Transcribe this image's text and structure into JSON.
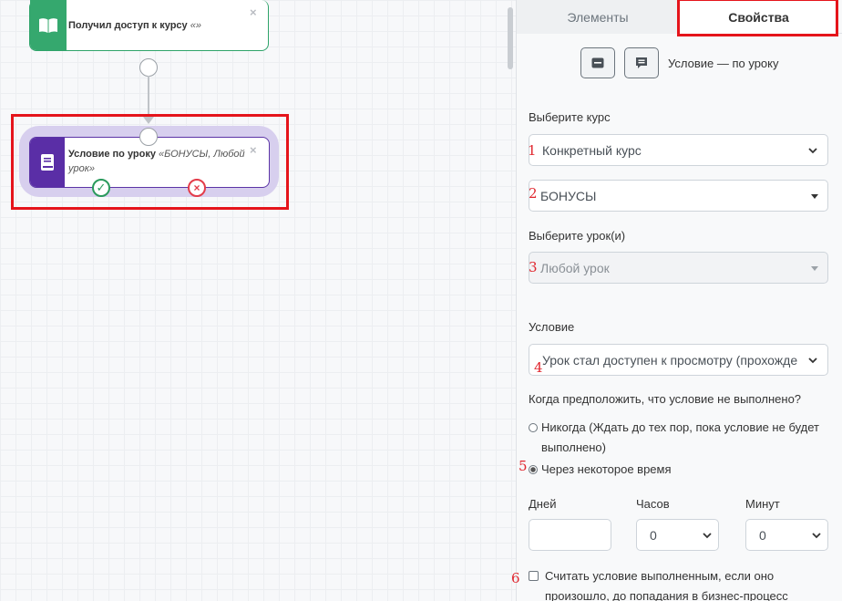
{
  "canvas": {
    "node1": {
      "title": "Получил доступ к курсу",
      "detail": "«»",
      "close": "×"
    },
    "node2": {
      "title": "Условие по уроку",
      "detail": "«БОНУСЫ, Любой урок»",
      "close": "×"
    },
    "ok_symbol": "✓",
    "fail_symbol": "×"
  },
  "colors": {
    "highlight": "#e5141b",
    "course_node": "#35a86e",
    "lesson_node": "#5a2ea6",
    "ok": "#2a9a5c",
    "fail": "#e33c4a"
  },
  "panel": {
    "tabs": {
      "elements": "Элементы",
      "properties": "Свойства"
    },
    "mode_label": "Условие — по уроку",
    "course_label": "Выберите курс",
    "course_type": "Конкретный курс",
    "course_value": "БОНУСЫ",
    "lesson_label": "Выберите урок(и)",
    "lesson_value": "Любой урок",
    "condition_label": "Условие",
    "condition_value": "Урок стал доступен к просмотру (прохожде",
    "fail_question": "Когда предположить, что условие не выполнено?",
    "radio_never": "Никогда (Ждать до тех пор, пока условие не будет выполнено)",
    "radio_after": "Через некоторое время",
    "days_label": "Дней",
    "hours_label": "Часов",
    "minutes_label": "Минут",
    "hours_value": "0",
    "minutes_value": "0",
    "checkbox_label": "Считать условие выполненным, если оно произошло, до попадания в бизнес-процесс"
  },
  "annotations": [
    "1",
    "2",
    "3",
    "4",
    "5",
    "6"
  ]
}
